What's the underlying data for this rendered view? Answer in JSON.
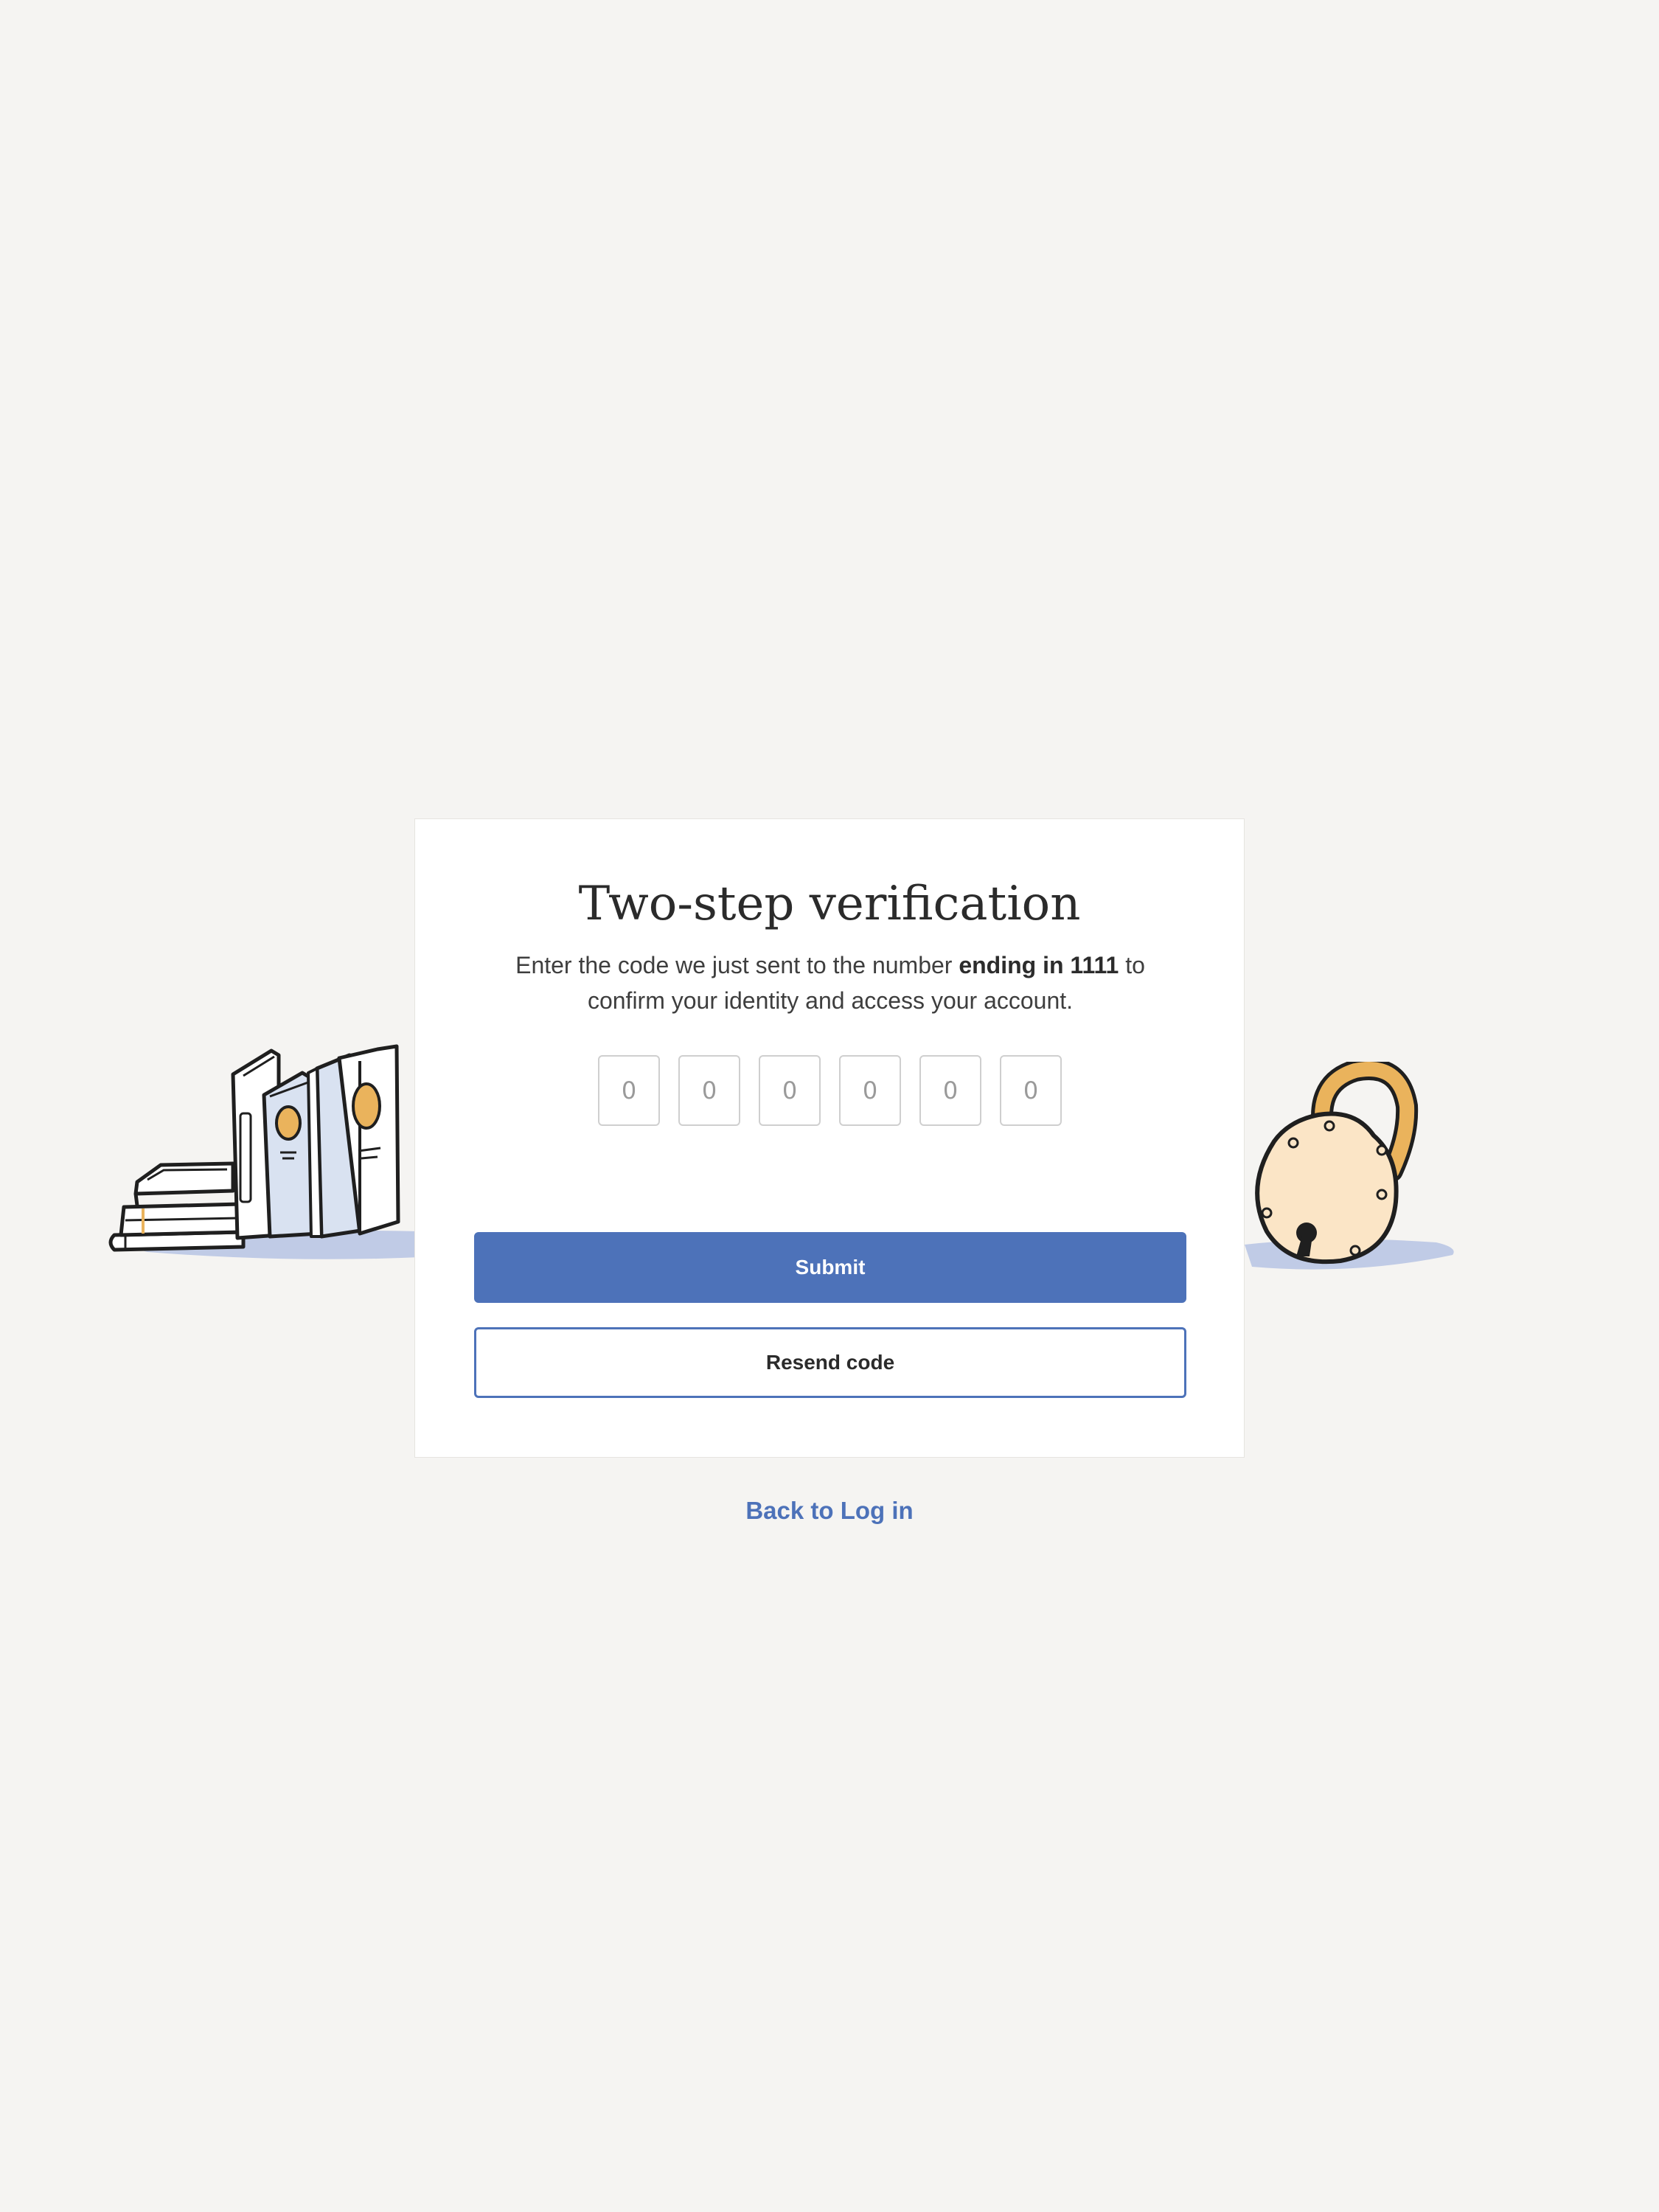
{
  "page": {
    "title": "Two-step verification",
    "subtitle_prefix": "Enter the code we just sent to the number ",
    "subtitle_emphasis": "ending in 1111",
    "subtitle_suffix": " to confirm your identity and access your account."
  },
  "code_inputs": {
    "placeholders": [
      "0",
      "0",
      "0",
      "0",
      "0",
      "0"
    ],
    "values": [
      "",
      "",
      "",
      "",
      "",
      ""
    ]
  },
  "actions": {
    "submit_label": "Submit",
    "resend_label": "Resend code",
    "back_label": "Back to Log in"
  },
  "illustrations": {
    "left": "books-illustration",
    "right": "padlock-illustration"
  },
  "colors": {
    "background": "#f5f4f2",
    "card": "#ffffff",
    "accent": "#4d72b9",
    "text": "#2b2b2b",
    "book_cover": "#d9e2f1",
    "book_emblem": "#eab35c",
    "lock_body": "#fbe5c6",
    "shadow": "#c0cbe6"
  }
}
